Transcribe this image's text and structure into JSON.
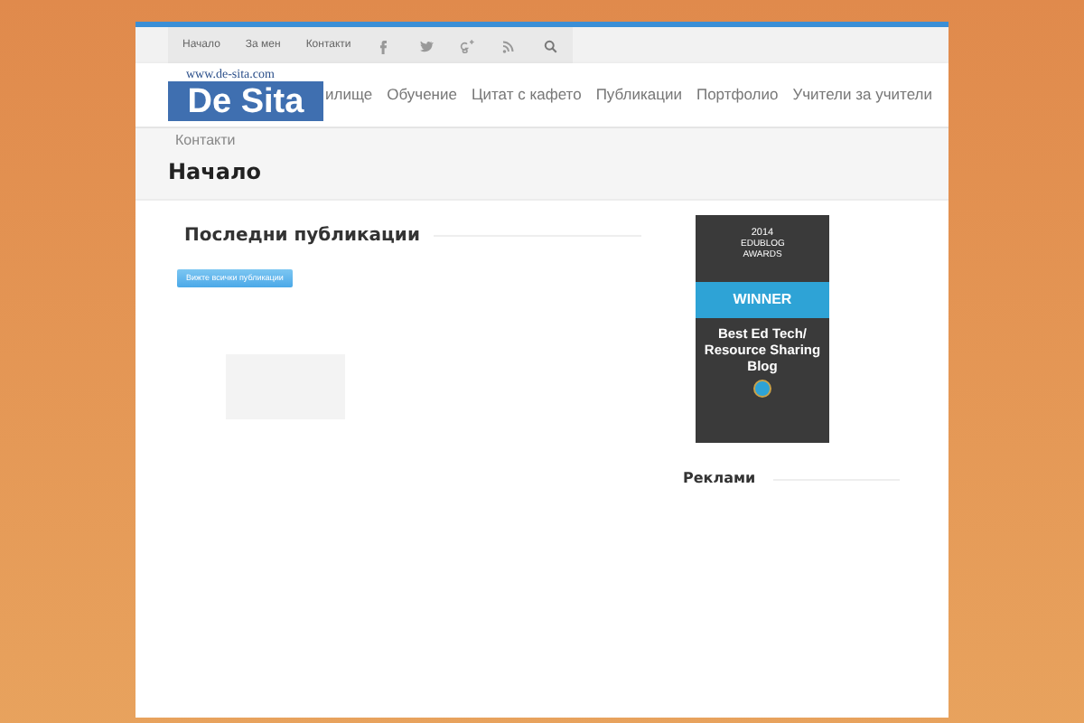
{
  "top_bar": {
    "links": [
      "Начало",
      "За мен",
      "Контакти"
    ]
  },
  "logo": {
    "url": "www.de-sita.com",
    "name": "De Sita"
  },
  "nav": [
    "илище",
    "Обучение",
    "Цитат с кафето",
    "Публикации",
    "Портфолио",
    "Учители за учители",
    "Контакти"
  ],
  "page_title": "Начало",
  "main": {
    "heading": "Последни публикации",
    "button": "Вижте всички публикации"
  },
  "sidebar": {
    "badge": {
      "year": "2014",
      "event": "EDUBLOG AWARDS",
      "ribbon": "WINNER",
      "category": "Best Ed Tech/ Resource Sharing Blog"
    },
    "heading": "Реклами"
  }
}
